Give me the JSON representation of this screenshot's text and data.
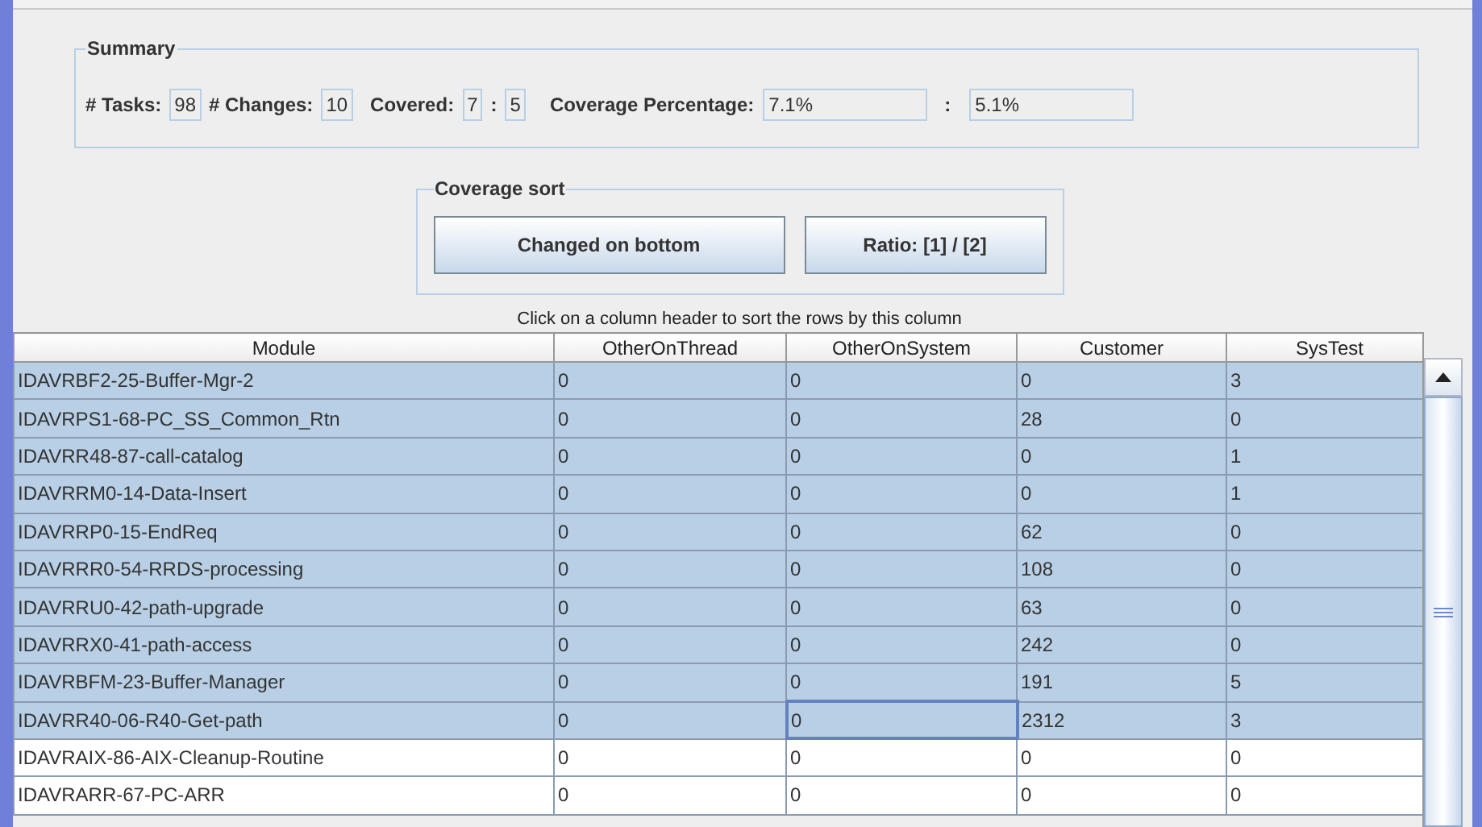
{
  "summary": {
    "title": "Summary",
    "fields": [
      {
        "label": "# Tasks:",
        "value": "98",
        "kind": "short"
      },
      {
        "label": "# Changes:",
        "value": "10",
        "kind": "short"
      },
      {
        "label": "Covered:",
        "value": "7",
        "kind": "short"
      },
      {
        "label": ":",
        "value": "5",
        "kind": "short"
      },
      {
        "label": "Coverage Percentage:",
        "value": "7.1%",
        "kind": "wide"
      },
      {
        "label": ":",
        "value": "5.1%",
        "kind": "wide"
      }
    ]
  },
  "coverage_sort": {
    "title": "Coverage sort",
    "buttons": [
      "Changed on bottom",
      "Ratio: [1] / [2]"
    ]
  },
  "hint": "Click on a column header to sort the rows by this column",
  "table": {
    "columns": [
      "Module",
      "OtherOnThread",
      "OtherOnSystem",
      "Customer",
      "SysTest"
    ],
    "rows": [
      {
        "cells": [
          "IDAVRBF2-25-Buffer-Mgr-2",
          "0",
          "0",
          "0",
          "3"
        ],
        "selected": true
      },
      {
        "cells": [
          "IDAVRPS1-68-PC_SS_Common_Rtn",
          "0",
          "0",
          "28",
          "0"
        ],
        "selected": true
      },
      {
        "cells": [
          "IDAVRR48-87-call-catalog",
          "0",
          "0",
          "0",
          "1"
        ],
        "selected": true
      },
      {
        "cells": [
          "IDAVRRM0-14-Data-Insert",
          "0",
          "0",
          "0",
          "1"
        ],
        "selected": true
      },
      {
        "cells": [
          "IDAVRRP0-15-EndReq",
          "0",
          "0",
          "62",
          "0"
        ],
        "selected": true
      },
      {
        "cells": [
          "IDAVRRR0-54-RRDS-processing",
          "0",
          "0",
          "108",
          "0"
        ],
        "selected": true
      },
      {
        "cells": [
          "IDAVRRU0-42-path-upgrade",
          "0",
          "0",
          "63",
          "0"
        ],
        "selected": true
      },
      {
        "cells": [
          "IDAVRRX0-41-path-access",
          "0",
          "0",
          "242",
          "0"
        ],
        "selected": true
      },
      {
        "cells": [
          "IDAVRBFM-23-Buffer-Manager",
          "0",
          "0",
          "191",
          "5"
        ],
        "selected": true
      },
      {
        "cells": [
          "IDAVRR40-06-R40-Get-path",
          "0",
          {
            "text": "0",
            "focused": true
          },
          "2312",
          "3"
        ],
        "selected": true
      },
      {
        "cells": [
          "IDAVRAIX-86-AIX-Cleanup-Routine",
          "0",
          "0",
          "0",
          "0"
        ],
        "selected": false
      },
      {
        "cells": [
          "IDAVRARR-67-PC-ARR",
          "0",
          "0",
          "0",
          "0"
        ],
        "selected": false
      }
    ]
  }
}
